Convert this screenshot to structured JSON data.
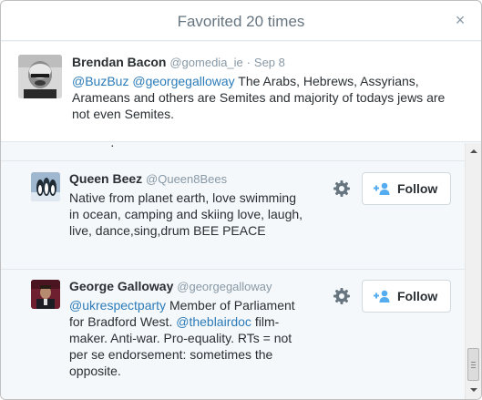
{
  "modal": {
    "title": "Favorited 20 times",
    "close_glyph": "×"
  },
  "tweet": {
    "fullname": "Brendan Bacon",
    "handle": "@gomedia_ie",
    "dot": "·",
    "time": "Sep 8",
    "mention1": "@BuzBuz",
    "mention2": "@georgegalloway",
    "text": "The Arabs, Hebrews, Assyrians, Arameans and others are Semites and majority of todays jews are not even Semites."
  },
  "users": [
    {
      "fullname": "Queen Beez",
      "handle": "@Queen8Bees",
      "bio": "Native from planet earth, love swimming in ocean, camping and skiing love, laugh, live, dance,sing,drum BEE PEACE",
      "follow_label": "Follow"
    },
    {
      "fullname": "George Galloway",
      "handle": "@georgegalloway",
      "bio_mention1": "@ukrespectparty",
      "bio_part1": "Member of Parliament for Bradford West.",
      "bio_mention2": "@theblairdoc",
      "bio_part2": "film-maker. Anti-war. Pro-equality. RTs = not per se endorsement: sometimes the opposite.",
      "follow_label": "Follow"
    }
  ],
  "icons": {
    "close": "close-icon",
    "gear": "gear-icon",
    "follow": "follow-user-icon"
  },
  "colors": {
    "link": "#2b7bb9",
    "secondary_text": "#8899a6",
    "primary_text": "#292f33",
    "background": "#f5f8fa"
  }
}
